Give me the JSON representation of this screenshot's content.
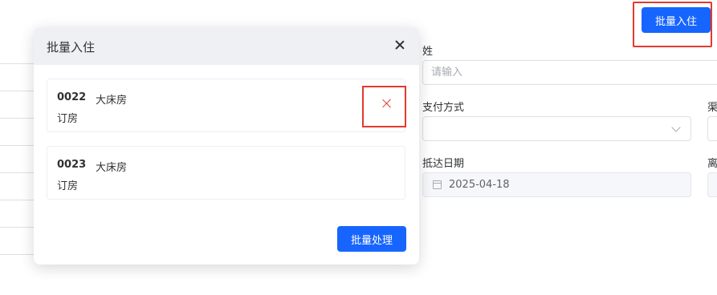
{
  "toolbar": {
    "batch_checkin_label": "批量入住"
  },
  "form": {
    "surname_label": "姓",
    "surname_placeholder": "请输入",
    "payment_label": "支付方式",
    "payment_value": "",
    "channel_label_partial": "渠",
    "arrival_label": "抵达日期",
    "arrival_value": "2025-04-18",
    "departure_label_partial": "离"
  },
  "dialog": {
    "title": "批量入住",
    "rooms": [
      {
        "number": "0022",
        "type": "大床房",
        "status": "订房"
      },
      {
        "number": "0023",
        "type": "大床房",
        "status": "订房"
      }
    ],
    "process_label": "批量处理"
  },
  "icons": [
    "close-icon",
    "remove-icon",
    "chevron-down-icon",
    "calendar-icon"
  ],
  "colors": {
    "primary": "#1765ff",
    "highlight": "#e3392f"
  }
}
